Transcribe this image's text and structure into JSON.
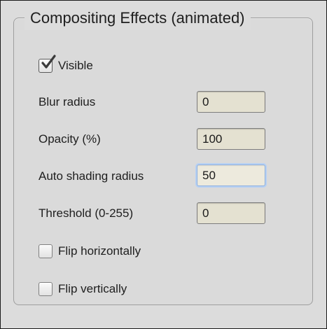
{
  "window": {
    "title": "Compositing Effects (animated)"
  },
  "visible": {
    "label": "Visible",
    "checked": true
  },
  "fields": {
    "blur_radius": {
      "label": "Blur radius",
      "value": "0"
    },
    "opacity": {
      "label": "Opacity (%)",
      "value": "100"
    },
    "auto_shading_radius": {
      "label": "Auto shading radius",
      "value": "50"
    },
    "threshold": {
      "label": "Threshold (0-255)",
      "value": "0"
    }
  },
  "checkboxes": {
    "flip_horizontally": {
      "label": "Flip horizontally",
      "checked": false
    },
    "flip_vertically": {
      "label": "Flip vertically",
      "checked": false
    }
  },
  "colors": {
    "panel_bg": "#dcdcdc",
    "field_bg": "#e4e1d1",
    "focus_ring": "#b8d1f2"
  },
  "icons": {
    "visible_check": "checkmark-icon"
  }
}
